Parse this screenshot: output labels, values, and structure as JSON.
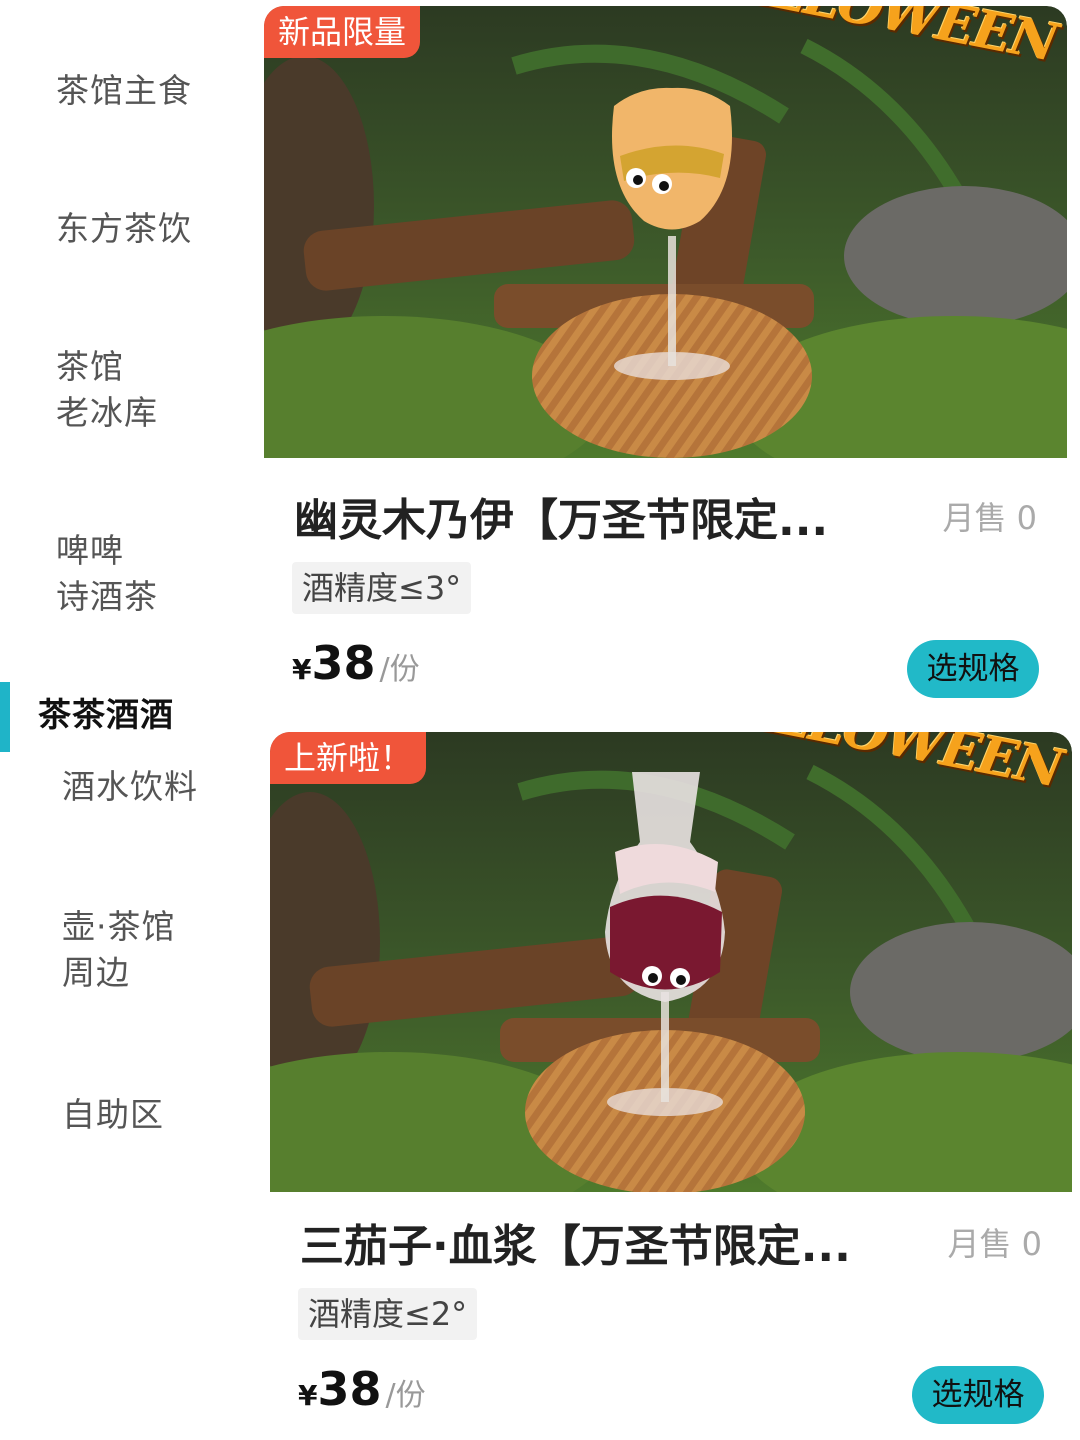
{
  "sidebar": {
    "items": [
      {
        "label": "茶馆主食"
      },
      {
        "label": "东方茶饮"
      },
      {
        "label": "茶馆\n老冰库"
      },
      {
        "label": "啤啤\n诗酒茶"
      },
      {
        "label": "茶茶酒酒",
        "active": true
      },
      {
        "label": "酒水饮料"
      },
      {
        "label": "壶·茶馆\n周边"
      },
      {
        "label": "自助区"
      }
    ],
    "accent_color": "#1fb4c8"
  },
  "products": [
    {
      "badge": "新品限量",
      "banner_text": "HALLOWEEN",
      "name": "幽灵木乃伊【万圣节限定...",
      "monthly_sales": "月售 0",
      "alcohol": "酒精度≤3°",
      "price_symbol": "¥",
      "price": "38",
      "unit": "/份",
      "button": "选规格",
      "photo_icon": "mummy-cocktail-photo"
    },
    {
      "badge": "上新啦！",
      "banner_text": "HALLOWEEN",
      "name": "三茄子·血浆【万圣节限定...",
      "monthly_sales": "月售 0",
      "alcohol": "酒精度≤2°",
      "price_symbol": "¥",
      "price": "38",
      "unit": "/份",
      "button": "选规格",
      "photo_icon": "blood-cocktail-photo"
    }
  ],
  "colors": {
    "badge": "#f0553a",
    "button": "#21b9c8"
  }
}
